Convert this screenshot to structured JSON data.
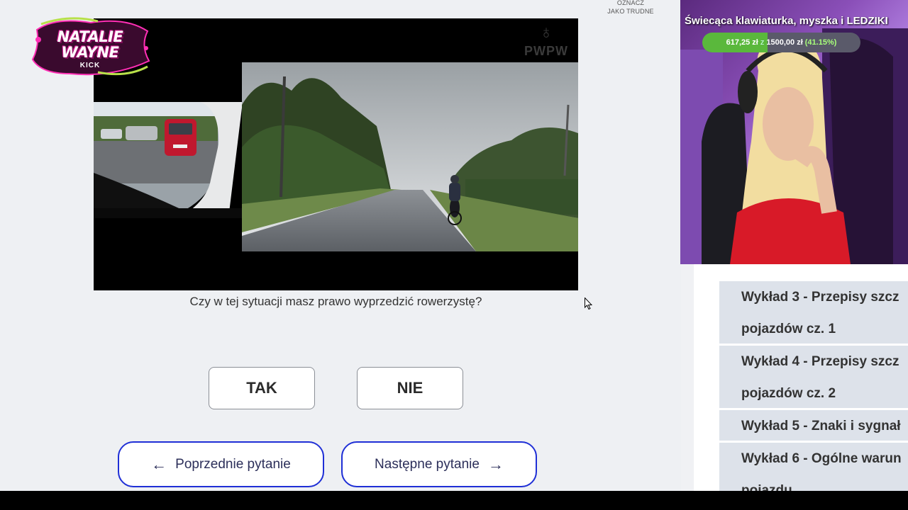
{
  "quiz": {
    "mark_hard_line1": "OZNACZ",
    "mark_hard_line2": "JAKO TRUDNE",
    "watermark": "PWPW",
    "question": "Czy w tej sytuacji masz prawo wyprzedzić rowerzystę?",
    "answers": [
      "TAK",
      "NIE"
    ],
    "prev_label": "Poprzednie pytanie",
    "next_label": "Następne pytanie",
    "prev_arrow": "←",
    "next_arrow": "→"
  },
  "overlay": {
    "logo_line1": "NATALIE",
    "logo_line2": "WAYNE",
    "logo_kick": "KICK",
    "goal_title": "Świecąca klawiaturka, myszka i LEDZIKI",
    "goal_current": "617,25 zł",
    "goal_sep": "z",
    "goal_target": "1500,00 zł",
    "goal_percent": "(41.15%)",
    "goal_fraction": 0.4115
  },
  "sidebar": {
    "items": [
      {
        "line1": "Wykład 3 - Przepisy szcz",
        "line2": "pojazdów cz. 1"
      },
      {
        "line1": "Wykład 4 - Przepisy szcz",
        "line2": "pojazdów cz. 2"
      },
      {
        "line1": "Wykład 5 - Znaki i sygnał",
        "line2": ""
      },
      {
        "line1": "Wykład 6 - Ogólne warun",
        "line2": "pojazdu"
      }
    ]
  },
  "colors": {
    "nav_border": "#1f2fd6",
    "goal_fill": "#5ab83c",
    "logo_pink": "#ff2fb5"
  }
}
